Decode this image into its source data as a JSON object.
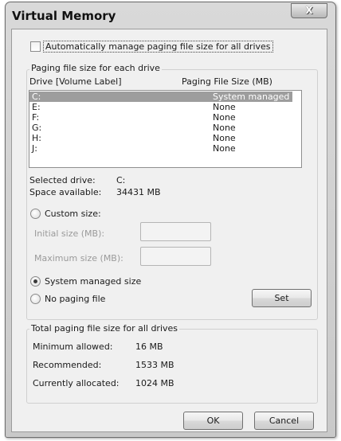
{
  "window": {
    "title": "Virtual Memory",
    "close_glyph": "X"
  },
  "auto_manage": {
    "label": "Automatically manage paging file size for all drives",
    "checked": false
  },
  "paging_group": {
    "title": "Paging file size for each drive",
    "col_drive": "Drive  [Volume Label]",
    "col_size": "Paging File Size (MB)",
    "drives": [
      {
        "drive": "C:",
        "size": "System managed",
        "selected": true
      },
      {
        "drive": "E:",
        "size": "None"
      },
      {
        "drive": "F:",
        "size": "None"
      },
      {
        "drive": "G:",
        "size": "None"
      },
      {
        "drive": "H:",
        "size": "None"
      },
      {
        "drive": "J:",
        "size": "None"
      }
    ],
    "selected_drive_label": "Selected drive:",
    "selected_drive_value": "C:",
    "space_label": "Space available:",
    "space_value": "34431 MB",
    "custom_size_label": "Custom size:",
    "initial_size_label": "Initial size (MB):",
    "maximum_size_label": "Maximum size (MB):",
    "initial_size_value": "",
    "maximum_size_value": "",
    "system_managed_label": "System managed size",
    "no_paging_label": "No paging file",
    "selected_option": "system_managed",
    "set_button": "Set"
  },
  "totals": {
    "title": "Total paging file size for all drives",
    "minimum_label": "Minimum allowed:",
    "minimum_value": "16 MB",
    "recommended_label": "Recommended:",
    "recommended_value": "1533 MB",
    "allocated_label": "Currently allocated:",
    "allocated_value": "1024 MB"
  },
  "buttons": {
    "ok": "OK",
    "cancel": "Cancel"
  },
  "colors": {
    "selection": "#9d9d9d",
    "client_bg": "#f0f0f0",
    "frame": "#c9c9c9"
  }
}
